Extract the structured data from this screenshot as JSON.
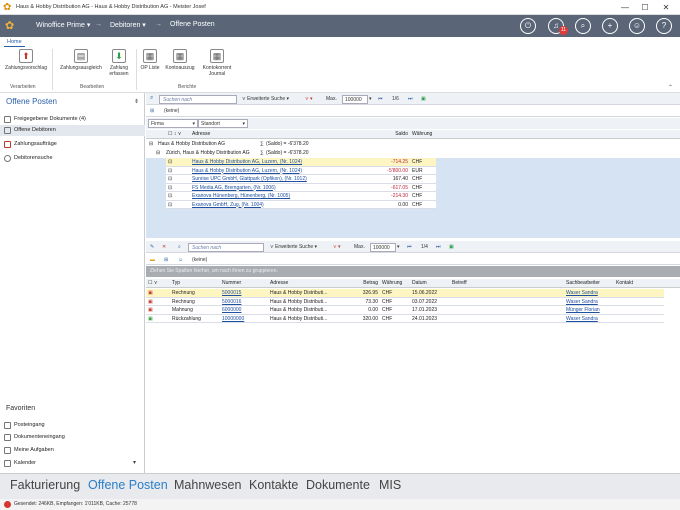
{
  "window": {
    "title": "Haus & Hobby Distribution AG - Haus & Hobby Distribution AG - Meister Josef",
    "minimize": "—",
    "maximize": "☐",
    "close": "✕"
  },
  "topnav": {
    "app": "Winoffice Prime",
    "crumb1": "Debitoren",
    "crumb2": "Offene Posten",
    "notifications_count": "11"
  },
  "ribbon": {
    "tab": "Home",
    "buttons": {
      "zahlungsvorschlag": "Zahlungsvorschlag",
      "zahlungsausgleich": "Zahlungsausgleich",
      "zahlung_erfassen_1": "Zahlung",
      "zahlung_erfassen_2": "erfassen",
      "op_liste": "OP Liste",
      "kontoauszug": "Kontoauszug",
      "kontokorrent_1": "Kontokorrent",
      "kontokorrent_2": "Journal"
    },
    "groups": {
      "verarbeiten": "Verarbeiten",
      "bearbeiten": "Bearbeiten",
      "berichte": "Berichte"
    }
  },
  "left": {
    "title": "Offene Posten",
    "items": [
      {
        "label": "Freigegebene Dokumente (4)"
      },
      {
        "label": "Offene Debitoren"
      },
      {
        "label": "Zahlungsaufträge"
      },
      {
        "label": "Debitorensuche"
      }
    ],
    "favorites_title": "Favoriten",
    "favorites": [
      {
        "label": "Posteingang"
      },
      {
        "label": "Dokumenteneingang"
      },
      {
        "label": "Meine Aufgaben"
      },
      {
        "label": "Kalender"
      }
    ]
  },
  "top_grid": {
    "search_placeholder": "Suchen nach",
    "advanced": "Erweiterte Suche",
    "max_label": "Max.",
    "max_value": "100000",
    "page": "1/6",
    "keine": "(keine)",
    "group1": "Firma",
    "group2": "Standort",
    "col_adresse": "Adresse",
    "col_saldo": "Saldo",
    "col_waehrung": "Währung",
    "group_firma": "Haus & Hobby Distribution AG",
    "group_firma_saldo": "(Saldo) = -6'378.20",
    "group_standort": "Zürich, Haus & Hobby Distribution AG",
    "group_standort_saldo": "(Saldo) = -6'378.20",
    "rows": [
      {
        "adresse": "Haus & Hobby Distribution AG, Luzern, (Nr. 1024)",
        "saldo": "-714.25",
        "waehrung": "CHF",
        "neg": true
      },
      {
        "adresse": "Haus & Hobby Distribution AG, Luzern, (Nr. 1024)",
        "saldo": "-5'800.00",
        "waehrung": "EUR",
        "neg": true
      },
      {
        "adresse": "Sunrise UPC GmbH, Glattpark (Opfikon), (Nr. 1012)",
        "saldo": "167.40",
        "waehrung": "CHF",
        "neg": false
      },
      {
        "adresse": "FS Media AG, Bremgarten, (Nr. 1006)",
        "saldo": "-617.05",
        "waehrung": "CHF",
        "neg": true
      },
      {
        "adresse": "Exanova Hünenberg, Hünenberg, (Nr. 1005)",
        "saldo": "-214.30",
        "waehrung": "CHF",
        "neg": true
      },
      {
        "adresse": "Exanova GmbH, Zug, (Nr. 1004)",
        "saldo": "0.00",
        "waehrung": "CHF",
        "neg": false
      }
    ]
  },
  "bottom_grid": {
    "search_placeholder": "Suchen nach",
    "advanced": "Erweiterte Suche",
    "max_label": "Max.",
    "max_value": "100000",
    "page": "1/4",
    "keine": "(keine)",
    "group_hint": "Ziehen Sie Spalten hierher, um nach ihnen zu gruppieren.",
    "headers": {
      "typ": "Typ",
      "nummer": "Nummer",
      "adresse": "Adresse",
      "betrag": "Betrag",
      "waehrung": "Währung",
      "datum": "Datum",
      "betreff": "Betreff",
      "sachbearbeiter": "Sachbearbeiter",
      "kontakt": "Kontakt"
    },
    "rows": [
      {
        "typ": "Rechnung",
        "nummer": "5000015",
        "adresse": "Haus & Hobby Distributi...",
        "betrag": "326.95",
        "waehrung": "CHF",
        "datum": "15.06.2022",
        "sachbearbeiter": "Waser Sandra"
      },
      {
        "typ": "Rechnung",
        "nummer": "5000016",
        "adresse": "Haus & Hobby Distributi...",
        "betrag": "73.30",
        "waehrung": "CHF",
        "datum": "03.07.2022",
        "sachbearbeiter": "Waser Sandra"
      },
      {
        "typ": "Mahnung",
        "nummer": "6000000",
        "adresse": "Haus & Hobby Distributi...",
        "betrag": "0.00",
        "waehrung": "CHF",
        "datum": "17.01.2023",
        "sachbearbeiter": "Münger Florian"
      },
      {
        "typ": "Rückzahlung",
        "nummer": "10000000",
        "adresse": "Haus & Hobby Distributi...",
        "betrag": "320.00",
        "waehrung": "CHF",
        "datum": "24.01.2023",
        "sachbearbeiter": "Waser Sandra"
      }
    ]
  },
  "modules": [
    "Fakturierung",
    "Offene Posten",
    "Mahnwesen",
    "Kontakte",
    "Dokumente",
    "MIS"
  ],
  "status": "Gesendet: 246KB, Empfangen: 1'011KB, Cache: 25778",
  "colors": {
    "accent": "#2a7fc9",
    "topnav": "#5a6678",
    "highlight": "#fdf6c2"
  }
}
